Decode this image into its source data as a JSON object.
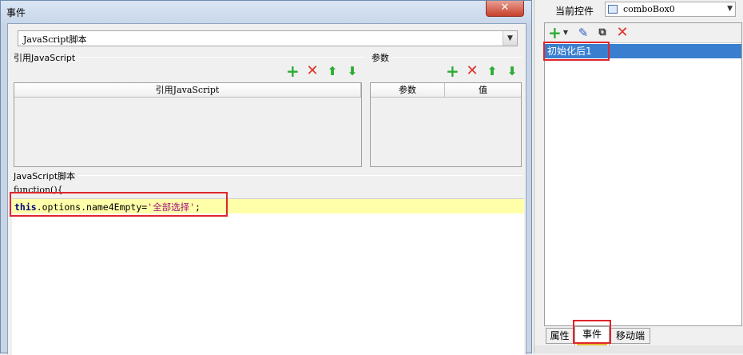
{
  "dialog": {
    "title": "事件",
    "close_label": "✕",
    "script_type": {
      "selected": "JavaScript脚本"
    },
    "refjs_section": {
      "label": "引用JavaScript",
      "column_header": "引用JavaScript"
    },
    "params_section": {
      "label": "参数",
      "columns": [
        "参数",
        "值"
      ]
    },
    "script_section": {
      "label": "JavaScript脚本",
      "code_prefix": "function(){"
    },
    "code": {
      "keyword": "this",
      "body": ".options.name4Empty=",
      "string": "'全部选择'",
      "end": ";"
    }
  },
  "right_panel": {
    "label": "当前控件",
    "control": {
      "selected": "comboBox0"
    },
    "events": [
      "初始化后1"
    ],
    "tabs": [
      {
        "label": "属性",
        "active": false
      },
      {
        "label": "事件",
        "active": true
      },
      {
        "label": "移动端",
        "active": false
      }
    ]
  },
  "icons": {
    "add": "plus-icon",
    "delete": "cross-icon",
    "move_up": "arrow-up-icon",
    "move_down": "arrow-down-icon",
    "edit": "pencil-icon",
    "copy": "copy-icon",
    "dropdown": "chevron-down-icon",
    "control_type": "combobox-icon"
  },
  "colors": {
    "selection": "#3a7fcf",
    "highlight_line": "#ffffaa",
    "annotation_box": "#e0262a",
    "add_icon": "#2bab33",
    "delete_icon": "#e0322a"
  }
}
